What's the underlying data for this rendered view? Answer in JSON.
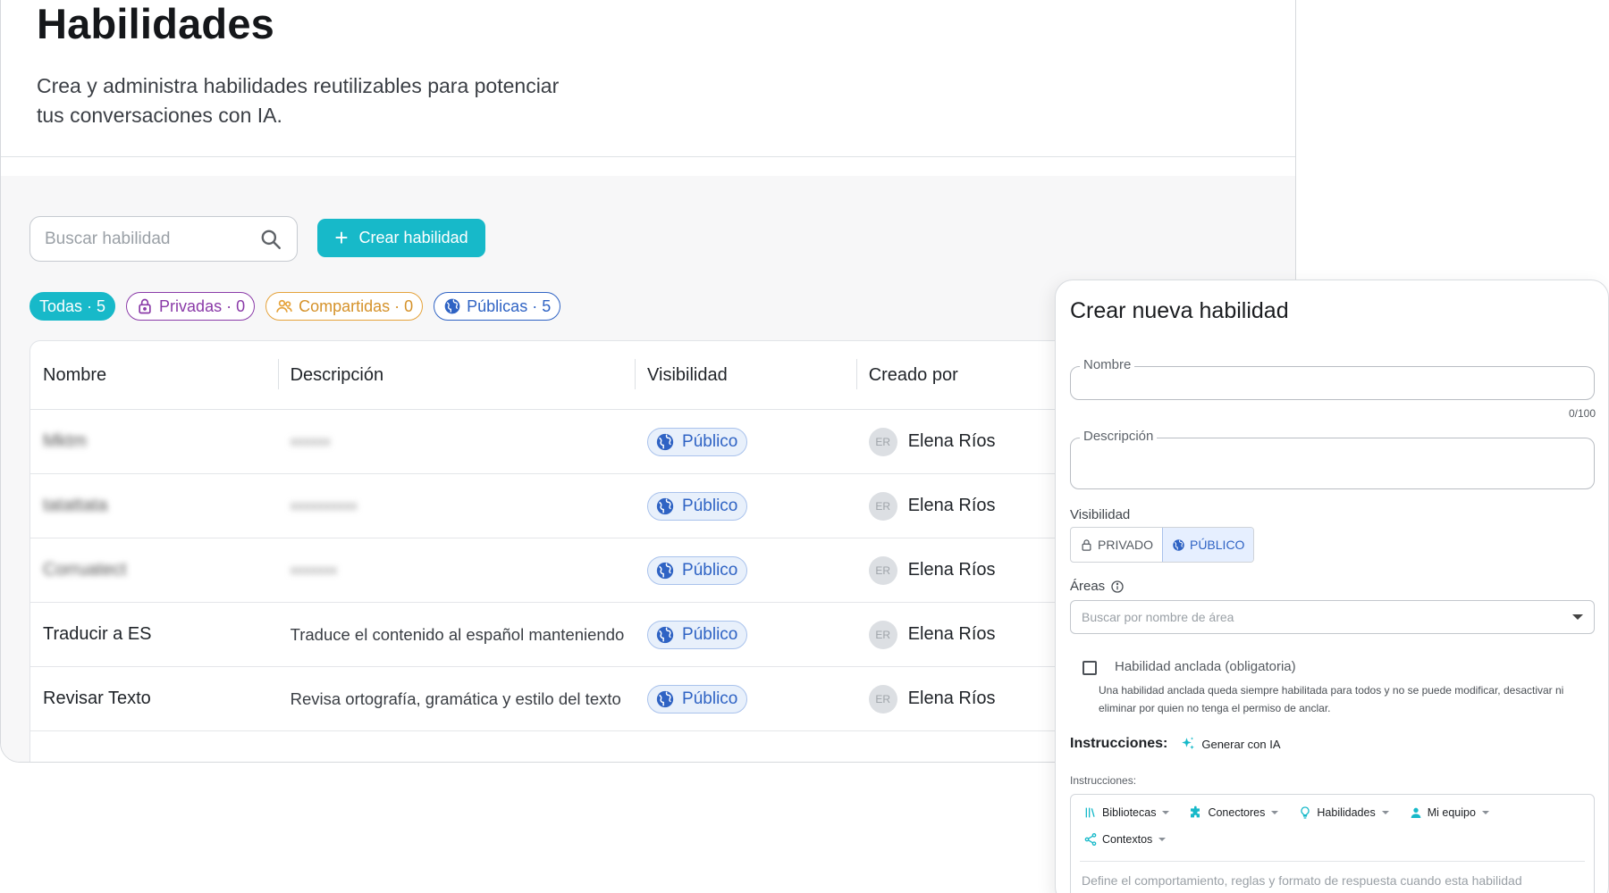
{
  "header": {
    "title": "Habilidades",
    "subtitle": "Crea y administra habilidades reutilizables para potenciar tus conversaciones con IA."
  },
  "toolbar": {
    "search_placeholder": "Buscar habilidad",
    "create_label": "Crear habilidad"
  },
  "filters": [
    {
      "label": "Todas · 5",
      "icon": "none",
      "color": "#17b9c9"
    },
    {
      "label": "Privadas · 0",
      "icon": "lock-icon",
      "color": "#8a3aa8"
    },
    {
      "label": "Compartidas · 0",
      "icon": "users-icon",
      "color": "#e5a23a"
    },
    {
      "label": "Públicas · 5",
      "icon": "globe-icon",
      "color": "#2f63c4"
    }
  ],
  "table": {
    "columns": [
      "Nombre",
      "Descripción",
      "Visibilidad",
      "Creado por"
    ],
    "rows": [
      {
        "name": "Mktm",
        "description": "xxxxxx",
        "visibility": "Público",
        "creator": "Elena Ríos",
        "initials": "ER",
        "blurred": true
      },
      {
        "name": "tatattata",
        "description": "xxxxxxxxxx",
        "visibility": "Público",
        "creator": "Elena Ríos",
        "initials": "ER",
        "blurred": true
      },
      {
        "name": "Corruatect",
        "description": "xxxxxxx",
        "visibility": "Público",
        "creator": "Elena Ríos",
        "initials": "ER",
        "blurred": true
      },
      {
        "name": "Traducir a ES",
        "description": "Traduce el contenido al español manteniendo",
        "visibility": "Público",
        "creator": "Elena Ríos",
        "initials": "ER",
        "blurred": false
      },
      {
        "name": "Revisar Texto",
        "description": "Revisa ortografía, gramática y estilo del texto",
        "visibility": "Público",
        "creator": "Elena Ríos",
        "initials": "ER",
        "blurred": false
      }
    ]
  },
  "modal": {
    "title": "Crear nueva habilidad",
    "name_label": "Nombre",
    "name_counter": "0/100",
    "description_label": "Descripción",
    "visibility_label": "Visibilidad",
    "visibility_private": "PRIVADO",
    "visibility_public": "PÚBLICO",
    "areas_label": "Áreas",
    "areas_placeholder": "Buscar por nombre de área",
    "pinned_label": "Habilidad anclada (obligatoria)",
    "pinned_help": "Una habilidad anclada queda siempre habilitada para todos y no se puede modificar, desactivar ni eliminar por quien no tenga el permiso de anclar.",
    "instructions_label": "Instrucciones:",
    "generate_label": "Generar con IA",
    "instructions_sublabel": "Instrucciones:",
    "tools": [
      "Bibliotecas",
      "Conectores",
      "Habilidades",
      "Mi equipo",
      "Contextos"
    ],
    "editor_placeholder": "Define el comportamiento, reglas y formato de respuesta cuando esta habilidad"
  },
  "colors": {
    "accent": "#17b9c9",
    "public": "#2f63c4",
    "private": "#8a3aa8",
    "shared": "#e5a23a"
  }
}
